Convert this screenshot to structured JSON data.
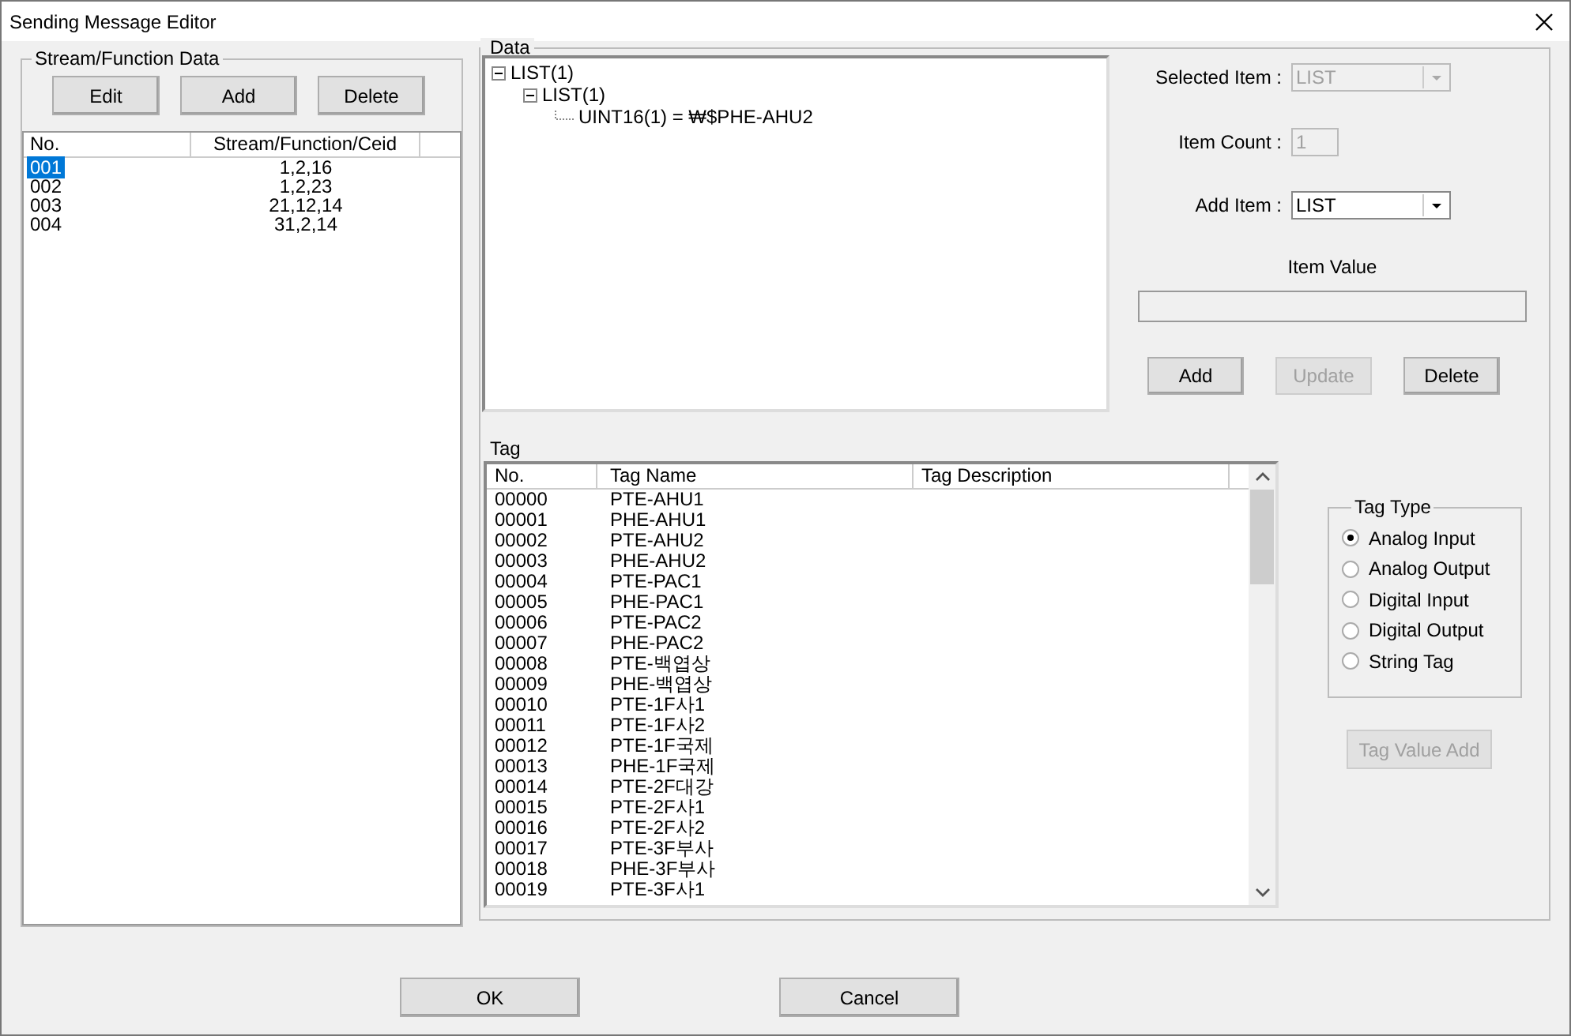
{
  "window": {
    "title": "Sending Message Editor"
  },
  "stream_function_data": {
    "title": "Stream/Function Data",
    "buttons": [
      "Edit",
      "Add",
      "Delete"
    ],
    "columns": [
      "No.",
      "Stream/Function/Ceid"
    ],
    "rows": [
      {
        "no": "001",
        "value": "1,2,16",
        "selected": true
      },
      {
        "no": "002",
        "value": "1,2,23",
        "selected": false
      },
      {
        "no": "003",
        "value": "21,12,14",
        "selected": false
      },
      {
        "no": "004",
        "value": "31,2,14",
        "selected": false
      }
    ]
  },
  "data": {
    "title": "Data",
    "tree": [
      {
        "label": "LIST(1)",
        "expanded": true,
        "children": [
          {
            "label": "LIST(1)",
            "expanded": true,
            "children": [
              {
                "label": "UINT16(1) = ₩$PHE-AHU2"
              }
            ]
          }
        ]
      }
    ],
    "selected_item": {
      "label": "Selected Item :",
      "value": "LIST",
      "disabled": true
    },
    "item_count": {
      "label": "Item Count :",
      "value": "1",
      "disabled": true
    },
    "add_item": {
      "label": "Add Item :",
      "value": "LIST",
      "disabled": false
    },
    "item_value": {
      "label": "Item Value",
      "disabled": true
    },
    "buttons": [
      {
        "label": "Add",
        "disabled": false
      },
      {
        "label": "Update",
        "disabled": true
      },
      {
        "label": "Delete",
        "disabled": false
      }
    ]
  },
  "tag": {
    "title": "Tag",
    "columns": [
      "No.",
      "Tag Name",
      "Tag Description"
    ],
    "rows": [
      {
        "no": "00000",
        "name": "PTE-AHU1"
      },
      {
        "no": "00001",
        "name": "PHE-AHU1"
      },
      {
        "no": "00002",
        "name": "PTE-AHU2"
      },
      {
        "no": "00003",
        "name": "PHE-AHU2"
      },
      {
        "no": "00004",
        "name": "PTE-PAC1"
      },
      {
        "no": "00005",
        "name": "PHE-PAC1"
      },
      {
        "no": "00006",
        "name": "PTE-PAC2"
      },
      {
        "no": "00007",
        "name": "PHE-PAC2"
      },
      {
        "no": "00008",
        "name": "PTE-백엽상"
      },
      {
        "no": "00009",
        "name": "PHE-백엽상"
      },
      {
        "no": "00010",
        "name": "PTE-1F사1"
      },
      {
        "no": "00011",
        "name": "PTE-1F사2"
      },
      {
        "no": "00012",
        "name": "PTE-1F국제"
      },
      {
        "no": "00013",
        "name": "PHE-1F국제"
      },
      {
        "no": "00014",
        "name": "PTE-2F대강"
      },
      {
        "no": "00015",
        "name": "PTE-2F사1"
      },
      {
        "no": "00016",
        "name": "PTE-2F사2"
      },
      {
        "no": "00017",
        "name": "PTE-3F부사"
      },
      {
        "no": "00018",
        "name": "PHE-3F부사"
      },
      {
        "no": "00019",
        "name": "PTE-3F사1"
      }
    ],
    "tag_type": {
      "title": "Tag Type",
      "options": [
        {
          "label": "Analog Input",
          "selected": true
        },
        {
          "label": "Analog Output",
          "selected": false
        },
        {
          "label": "Digital Input",
          "selected": false
        },
        {
          "label": "Digital Output",
          "selected": false
        },
        {
          "label": "String Tag",
          "selected": false
        }
      ]
    },
    "tag_value_add": {
      "label": "Tag Value Add",
      "disabled": true
    }
  },
  "buttons": [
    "OK",
    "Cancel"
  ]
}
